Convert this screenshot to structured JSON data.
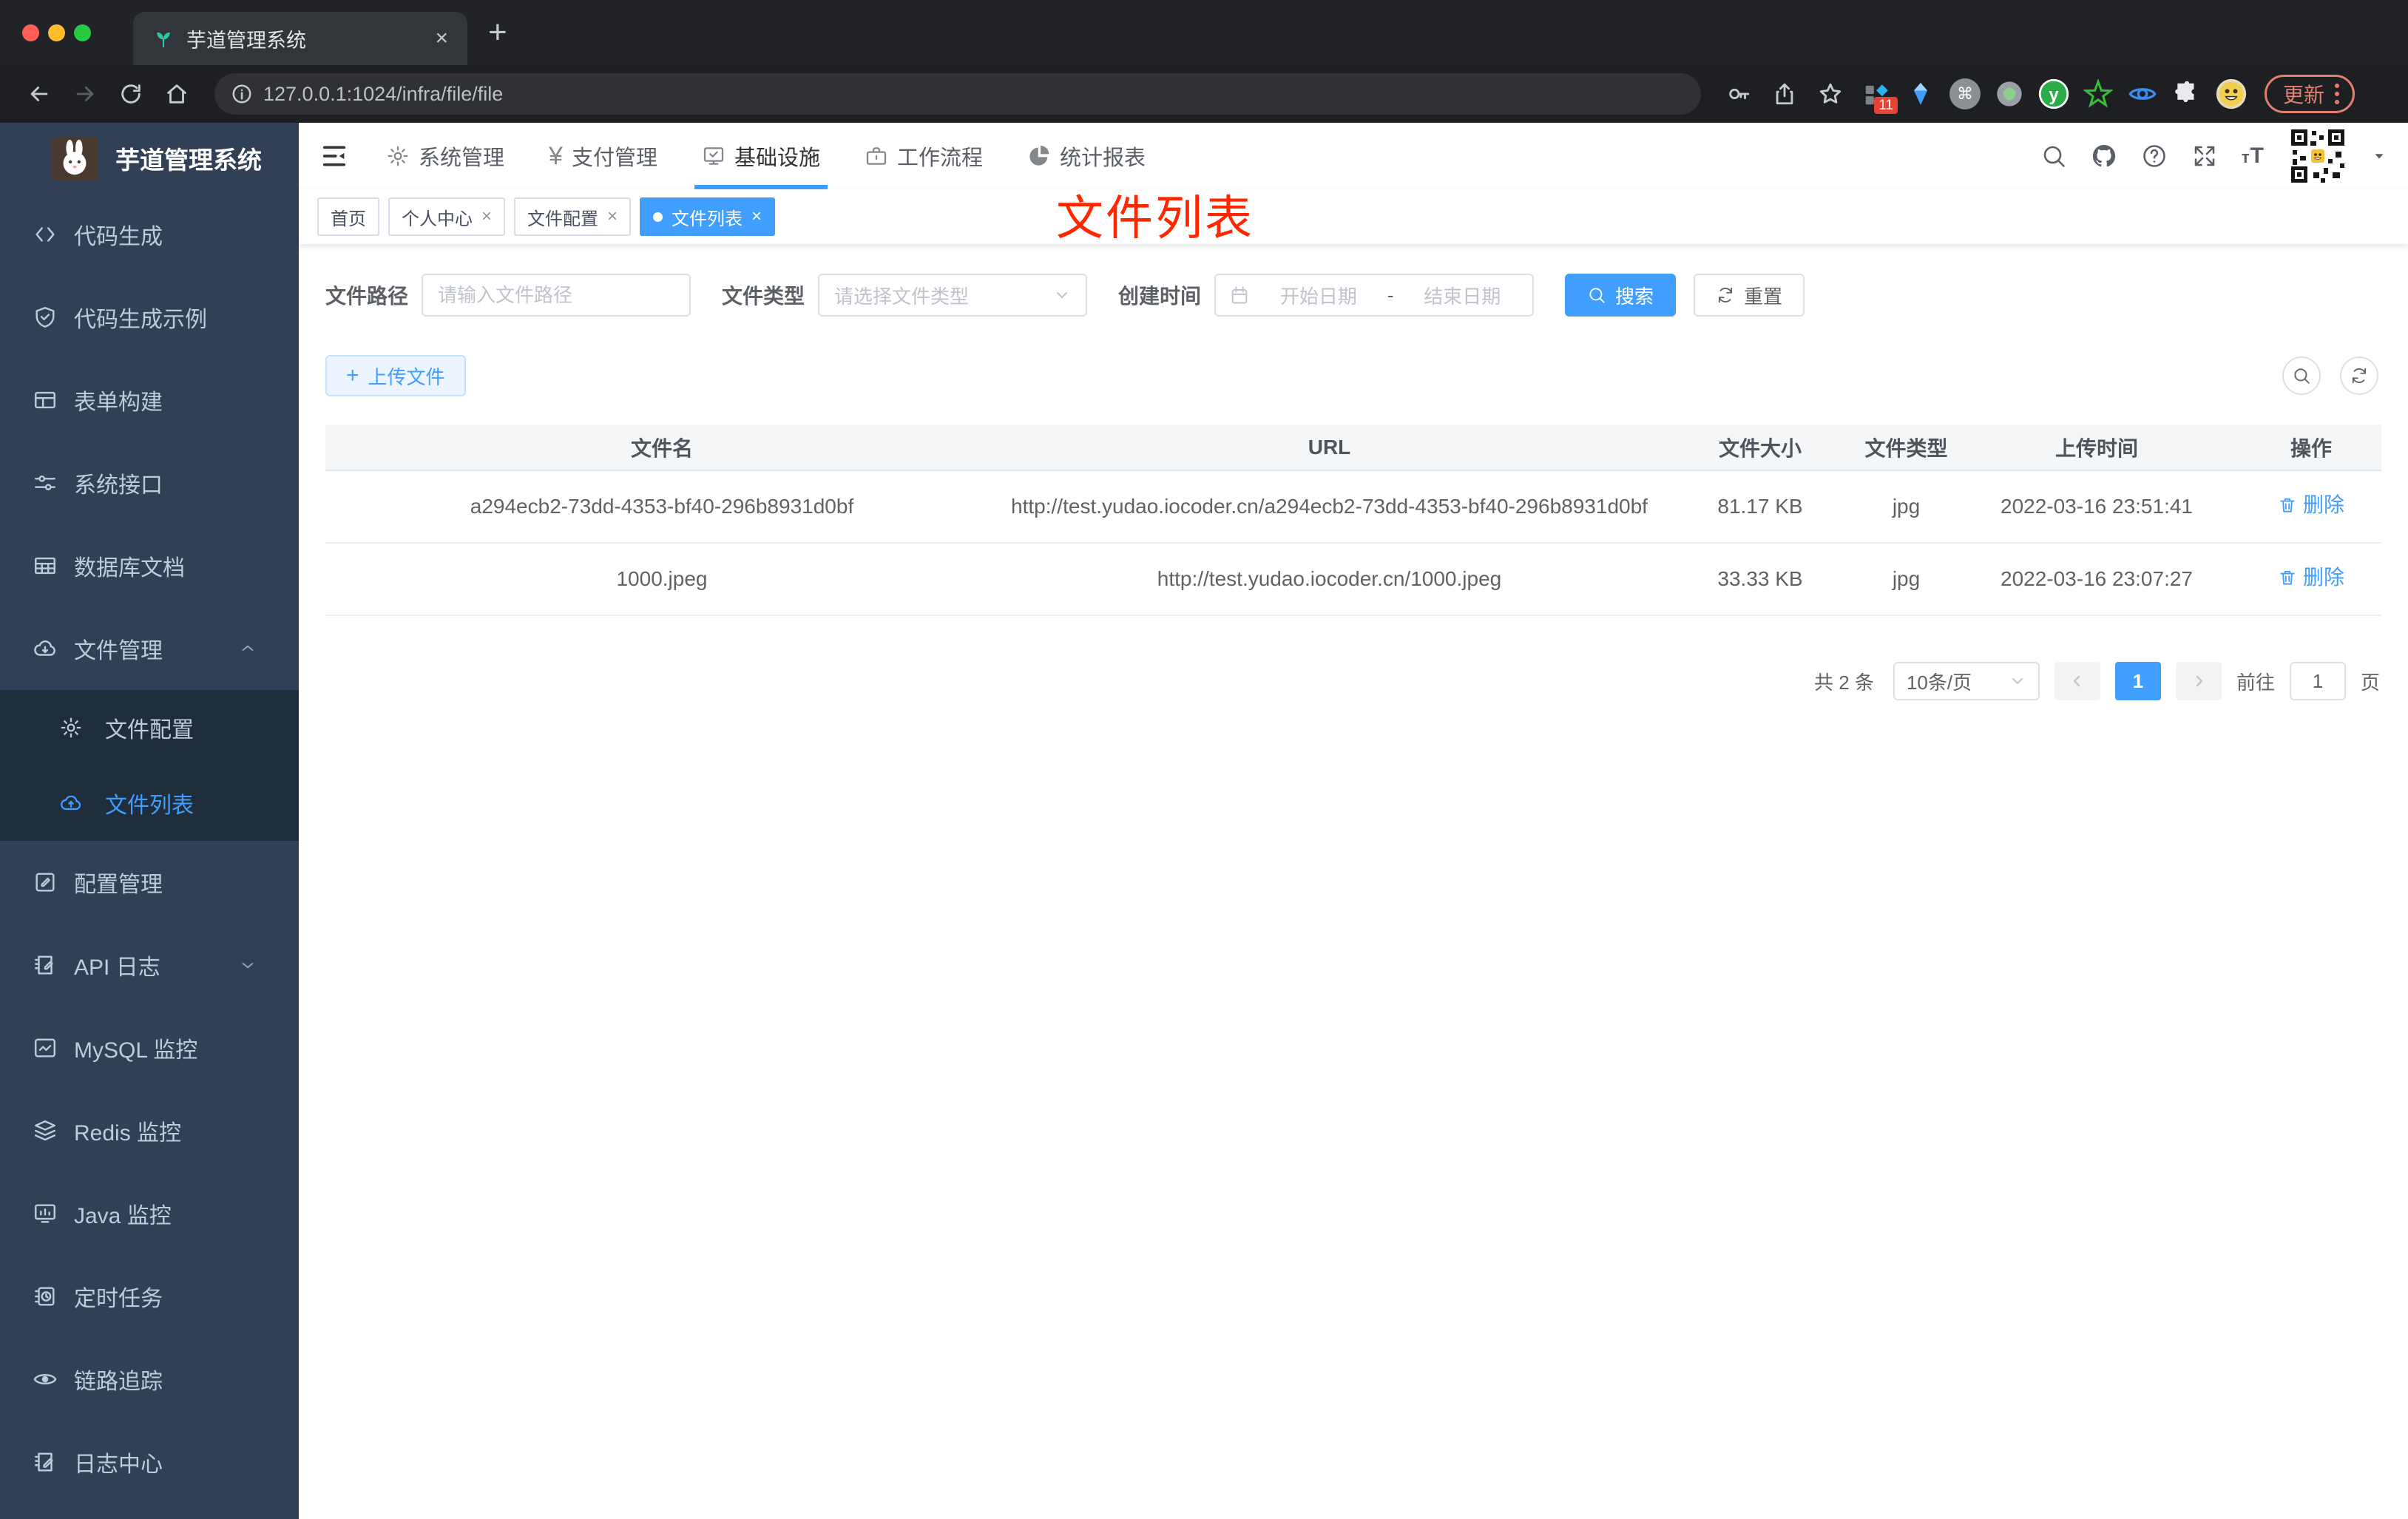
{
  "browser": {
    "tab": {
      "title": "芋道管理系统"
    },
    "url": "127.0.0.1:1024/infra/file/file",
    "extensions_badge": "11",
    "update_label": "更新"
  },
  "glyphs": {
    "close": "×",
    "newtab": "+",
    "plus": "+",
    "yen": "¥",
    "cmd": "⌘",
    "y": "y",
    "font_size_small": "т",
    "font_size_big": "T"
  },
  "header": {
    "nav": [
      {
        "label": "系统管理"
      },
      {
        "label": "支付管理"
      },
      {
        "label": "基础设施"
      },
      {
        "label": "工作流程"
      },
      {
        "label": "统计报表"
      }
    ]
  },
  "sidebar": {
    "title": "芋道管理系统",
    "items": [
      {
        "label": "代码生成"
      },
      {
        "label": "代码生成示例"
      },
      {
        "label": "表单构建"
      },
      {
        "label": "系统接口"
      },
      {
        "label": "数据库文档"
      },
      {
        "label": "文件管理"
      },
      {
        "label": "文件配置"
      },
      {
        "label": "文件列表"
      },
      {
        "label": "配置管理"
      },
      {
        "label": "API 日志"
      },
      {
        "label": "MySQL 监控"
      },
      {
        "label": "Redis 监控"
      },
      {
        "label": "Java 监控"
      },
      {
        "label": "定时任务"
      },
      {
        "label": "链路追踪"
      },
      {
        "label": "日志中心"
      }
    ]
  },
  "tags": [
    {
      "label": "首页"
    },
    {
      "label": "个人中心"
    },
    {
      "label": "文件配置"
    },
    {
      "label": "文件列表"
    }
  ],
  "annotation": "文件列表",
  "filters": {
    "path_label": "文件路径",
    "path_placeholder": "请输入文件路径",
    "type_label": "文件类型",
    "type_placeholder": "请选择文件类型",
    "date_label": "创建时间",
    "date_start": "开始日期",
    "date_sep": "-",
    "date_end": "结束日期",
    "search": "搜索",
    "reset": "重置"
  },
  "toolbar": {
    "upload": "上传文件"
  },
  "table": {
    "columns": [
      "文件名",
      "URL",
      "文件大小",
      "文件类型",
      "上传时间",
      "操作"
    ],
    "rows": [
      {
        "name": "a294ecb2-73dd-4353-bf40-296b8931d0bf",
        "url": "http://test.yudao.iocoder.cn/a294ecb2-73dd-4353-bf40-296b8931d0bf",
        "size": "81.17 KB",
        "type": "jpg",
        "time": "2022-03-16 23:51:41",
        "action": "删除"
      },
      {
        "name": "1000.jpeg",
        "url": "http://test.yudao.iocoder.cn/1000.jpeg",
        "size": "33.33 KB",
        "type": "jpg",
        "time": "2022-03-16 23:07:27",
        "action": "删除"
      }
    ]
  },
  "pagination": {
    "total": "共 2 条",
    "per_page": "10条/页",
    "page": "1",
    "goto": "前往",
    "goto_value": "1",
    "unit": "页"
  }
}
